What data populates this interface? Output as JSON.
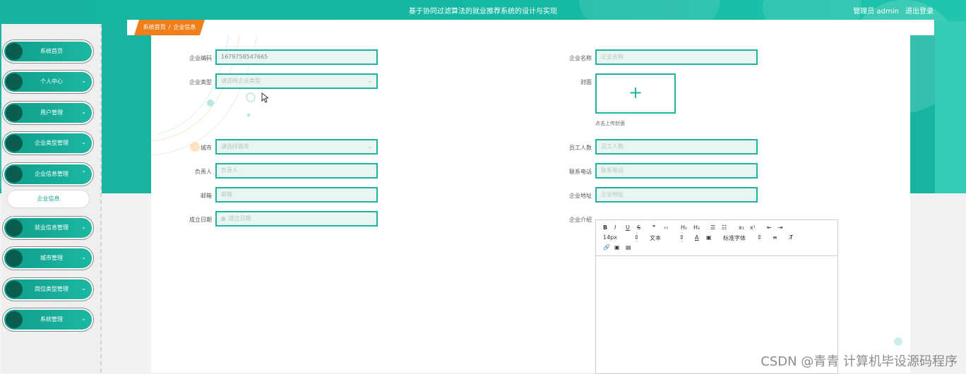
{
  "header": {
    "title": "基于协同过滤算法的就业推荐系统的设计与实现",
    "user_label": "管理员 admin",
    "logout_label": "退出登录"
  },
  "sidebar": {
    "items": [
      {
        "label": "系统首页",
        "chevron": ""
      },
      {
        "label": "个人中心",
        "chevron": "⌄"
      },
      {
        "label": "用户管理",
        "chevron": "⌄"
      },
      {
        "label": "企业类型管理",
        "chevron": "⌄"
      },
      {
        "label": "企业信息管理",
        "chevron": "⌃"
      },
      {
        "label": "就业信息管理",
        "chevron": "⌄"
      },
      {
        "label": "城市管理",
        "chevron": "⌄"
      },
      {
        "label": "岗位类型管理",
        "chevron": "⌄"
      },
      {
        "label": "系统管理",
        "chevron": "⌄"
      }
    ],
    "sub_item": "企业信息"
  },
  "breadcrumb": {
    "home": "系统首页",
    "separator": "/",
    "current": "企业信息"
  },
  "form": {
    "company_code": {
      "label": "企业编码",
      "value": "1679758547665"
    },
    "company_name": {
      "label": "企业名称",
      "placeholder": "企业名称"
    },
    "company_type": {
      "label": "企业类型",
      "placeholder": "请选择企业类型"
    },
    "cover": {
      "label": "封面",
      "hint": "点击上传封面"
    },
    "city": {
      "label": "城市",
      "placeholder": "请选择城市"
    },
    "employees": {
      "label": "员工人数",
      "placeholder": "员工人数"
    },
    "owner": {
      "label": "负责人",
      "placeholder": "负责人"
    },
    "phone": {
      "label": "联系电话",
      "placeholder": "联系电话"
    },
    "email": {
      "label": "邮箱",
      "placeholder": "邮箱"
    },
    "address": {
      "label": "企业地址",
      "placeholder": "企业地址"
    },
    "established": {
      "label": "成立日期",
      "placeholder": "成立日期"
    },
    "intro": {
      "label": "企业介绍"
    }
  },
  "editor": {
    "row1": [
      "B",
      "I",
      "U",
      "S",
      "❞",
      "‹›",
      "H₁",
      "H₂",
      "☰",
      "☷",
      "x₁",
      "x¹",
      "⇤",
      "⇥"
    ],
    "font_size": "14px",
    "text_style": "文本",
    "font_family": "标准字体",
    "row3": [
      "🔗",
      "▣",
      "▤"
    ]
  },
  "watermark": "CSDN @青青  计算机毕设源码程序",
  "colors": {
    "accent": "#1db39f",
    "crumb": "#f07f1b"
  }
}
